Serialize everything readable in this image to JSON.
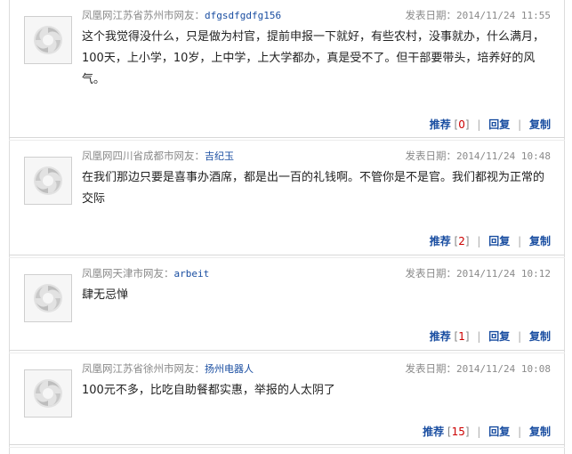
{
  "comments": [
    {
      "location": "凤凰网江苏省苏州市网友：",
      "user": "dfgsdfgdfg156",
      "time_label": "发表日期：",
      "time": "2014/11/24 11:55",
      "text": "这个我觉得没什么，只是做为村官，提前申报一下就好，有些农村，没事就办，什么满月，100天，上小学，10岁，上中学，上大学都办，真是受不了。但干部要带头，培养好的风气。",
      "recommend": "推荐",
      "count_open": "[",
      "count": "0",
      "count_close": "]",
      "reply": "回复",
      "copy": "复制"
    },
    {
      "location": "凤凰网四川省成都市网友：",
      "user": "吉纪玉",
      "time_label": "发表日期：",
      "time": "2014/11/24 10:48",
      "text": "在我们那边只要是喜事办酒席，都是出一百的礼钱啊。不管你是不是官。我们都视为正常的交际",
      "recommend": "推荐",
      "count_open": "[",
      "count": "2",
      "count_close": "]",
      "reply": "回复",
      "copy": "复制"
    },
    {
      "location": "凤凰网天津市网友：",
      "user": "arbeit",
      "time_label": "发表日期：",
      "time": "2014/11/24 10:12",
      "text": "肆无忌惮",
      "recommend": "推荐",
      "count_open": "[",
      "count": "1",
      "count_close": "]",
      "reply": "回复",
      "copy": "复制"
    },
    {
      "location": "凤凰网江苏省徐州市网友：",
      "user": "扬州电器人",
      "time_label": "发表日期：",
      "time": "2014/11/24 10:08",
      "text": "100元不多，比吃自助餐都实惠，举报的人太阴了",
      "recommend": "推荐",
      "count_open": "[",
      "count": "15",
      "count_close": "]",
      "reply": "回复",
      "copy": "复制"
    }
  ],
  "icons": {
    "avatar": "phoenix-logo-icon"
  },
  "colors": {
    "link": "#1a4ea1",
    "count": "#cc0000",
    "meta": "#8a8a8a"
  }
}
